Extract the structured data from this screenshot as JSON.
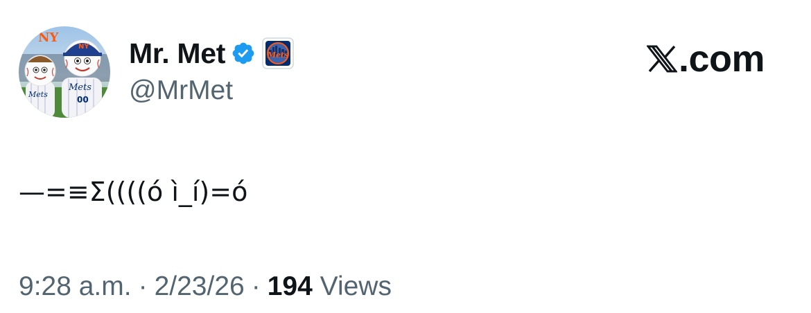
{
  "author": {
    "display_name": "Mr. Met",
    "handle": "@MrMet",
    "verified": true,
    "affiliate_badge": "mets-logo-badge"
  },
  "branding": {
    "site_label": ".com",
    "logo_icon": "x-logo-icon"
  },
  "tweet": {
    "text": "—=≡Σ((((ó ì_í)=ó"
  },
  "meta": {
    "time": "9:28 a.m.",
    "separator": "·",
    "date": "2/23/26",
    "views_count": "194",
    "views_label": "Views"
  },
  "colors": {
    "text_primary": "#0f1419",
    "text_secondary": "#536471",
    "verified_blue": "#1d9bf0",
    "mets_blue": "#002d72",
    "mets_orange": "#ff5910"
  }
}
